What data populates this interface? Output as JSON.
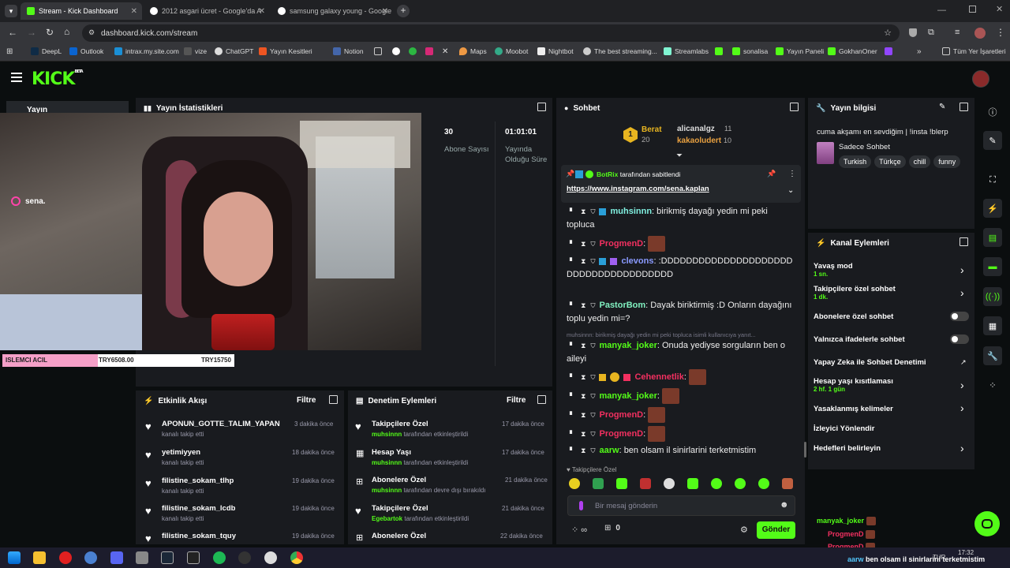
{
  "browser": {
    "tabs": [
      {
        "title": "Stream - Kick Dashboard",
        "active": true
      },
      {
        "title": "2012 asgari ücret - Google'da A"
      },
      {
        "title": "samsung galaxy young - Google"
      }
    ],
    "url": "dashboard.kick.com/stream",
    "bookmarks": [
      "DeepL",
      "Outlook",
      "intrax.my.site.com",
      "vize",
      "ChatGPT",
      "Yayın Kesitleri",
      "Notion",
      "Maps",
      "Moobot",
      "Nightbot",
      "The best streaming...",
      "Streamlabs",
      "sonalisa",
      "Yayın Paneli",
      "GokhanOner"
    ],
    "all_bookmarks": "Tüm Yer İşaretleri"
  },
  "kick": {
    "logo": "KICK",
    "logo_beta": "BETA",
    "sidebar_label": "Yayın"
  },
  "stats": {
    "title": "Yayın İstatistikleri",
    "subs_value": "30",
    "subs_label": "Abone Sayısı",
    "duration_value": "01:01:01",
    "duration_label": "Yayında Olduğu Süre"
  },
  "stream": {
    "overlay_name": "sena.",
    "donation_label": "ISLEMCI ACIL",
    "donation_current": "TRY6508.00",
    "donation_goal": "TRY15750"
  },
  "activity": {
    "title": "Etkinlik Akışı",
    "filter": "Filtre",
    "items": [
      {
        "name": "APONUN_GOTTE_TALIM_YAPAN",
        "desc": "kanalı takip etti",
        "time": "3 dakika önce"
      },
      {
        "name": "yetimiyyen",
        "desc": "kanalı takip etti",
        "time": "18 dakika önce"
      },
      {
        "name": "filistine_sokam_tlhp",
        "desc": "kanalı takip etti",
        "time": "19 dakika önce"
      },
      {
        "name": "filistine_sokam_lcdb",
        "desc": "kanalı takip etti",
        "time": "19 dakika önce"
      },
      {
        "name": "filistine_sokam_tquy",
        "desc": "",
        "time": "19 dakika önce"
      }
    ]
  },
  "moderation": {
    "title": "Denetim Eylemleri",
    "filter": "Filtre",
    "items": [
      {
        "action": "Takipçilere Özel",
        "user": "muhsinnn",
        "desc": "tarafından etkinleştirildi",
        "time": "17 dakika önce"
      },
      {
        "action": "Hesap Yaşı",
        "user": "muhsinnn",
        "desc": "tarafından etkinleştirildi",
        "time": "17 dakika önce"
      },
      {
        "action": "Abonelere Özel",
        "user": "muhsinnn",
        "desc": "tarafından devre dışı bırakıldı",
        "time": "21 dakika önce"
      },
      {
        "action": "Takipçilere Özel",
        "user": "Egebartok",
        "desc": "tarafından etkinleştirildi",
        "time": "21 dakika önce"
      },
      {
        "action": "Abonelere Özel",
        "user": "",
        "desc": "",
        "time": "22 dakika önce"
      }
    ]
  },
  "chat": {
    "title": "Sohbet",
    "leaderboard": [
      {
        "name": "Berat",
        "count": "20"
      },
      {
        "name": "alicanalgz",
        "count": "11"
      },
      {
        "name": "kakaoludert",
        "count": "10"
      }
    ],
    "pinned_by": "BotRix",
    "pinned_suffix": "tarafından sabitlendi",
    "pinned_link": "https://www.instagram.com/sena.kaplan",
    "messages": [
      {
        "user": "muhsinnn",
        "text": "birikmiş dayağı yedin mi peki topluca"
      },
      {
        "user": "ProgmenD",
        "text": ""
      },
      {
        "user": "clevons",
        "text": ":DDDDDDDDDDDDDDDDDDDDDDDDDDDDDDDDDDDDDD"
      },
      {
        "user": "PastorBom",
        "text": "Dayak biriktirmiş :D Onların dayağını toplu yedin mi=?"
      },
      {
        "user": "manyak_joker",
        "text": "Onuda yediyse sorguların ben o aileyi"
      },
      {
        "user": "Cehennetlik",
        "text": ""
      },
      {
        "user": "manyak_joker",
        "text": ""
      },
      {
        "user": "ProgmenD",
        "text": ""
      },
      {
        "user": "ProgmenD",
        "text": ""
      },
      {
        "user": "aarw",
        "text": "ben olsam il sinirlarini terketmistim"
      }
    ],
    "reply_preview": "muhsinnn: birikmiş dayağı yedin mi peki topluca isimli kullanıcıya yanıt...",
    "followers_only": "Takipçilere Özel",
    "input_placeholder": "Bir mesaj gönderin",
    "points": "0",
    "send": "Gönder"
  },
  "stream_info": {
    "title": "Yayın bilgisi",
    "stream_title": "cuma akşamı en sevdiğim | !insta !blerp",
    "category": "Sadece Sohbet",
    "tags": [
      "Turkish",
      "Türkçe",
      "chill",
      "funny"
    ]
  },
  "channel_actions": {
    "title": "Kanal Eylemleri",
    "items": [
      {
        "label": "Yavaş mod",
        "sub": "1 sn."
      },
      {
        "label": "Takipçilere özel sohbet",
        "sub": "1 dk."
      },
      {
        "label": "Abonelere özel sohbet",
        "sub": ""
      },
      {
        "label": "Yalnızca ifadelerle sohbet",
        "sub": ""
      },
      {
        "label": "Yapay Zeka ile Sohbet Denetimi",
        "sub": ""
      },
      {
        "label": "Hesap yaşı kısıtlaması",
        "sub": "2 hf. 1 gün"
      },
      {
        "label": "Yasaklanmış kelimeler",
        "sub": ""
      },
      {
        "label": "İzleyici Yönlendir",
        "sub": ""
      },
      {
        "label": "Hedefleri belirleyin",
        "sub": ""
      }
    ]
  },
  "overlay_chat": [
    {
      "user": "manyak_joker"
    },
    {
      "user": "ProgmenD"
    },
    {
      "user": "ProgmenD"
    },
    {
      "user": "aarw",
      "text": "ben olsam il sinirlarini terketmistim"
    }
  ],
  "taskbar": {
    "lang": "TUR",
    "time": "17:32"
  },
  "colors": {
    "accent": "#53fc18",
    "panel": "#191b1f",
    "bg": "#0b0e0f"
  }
}
